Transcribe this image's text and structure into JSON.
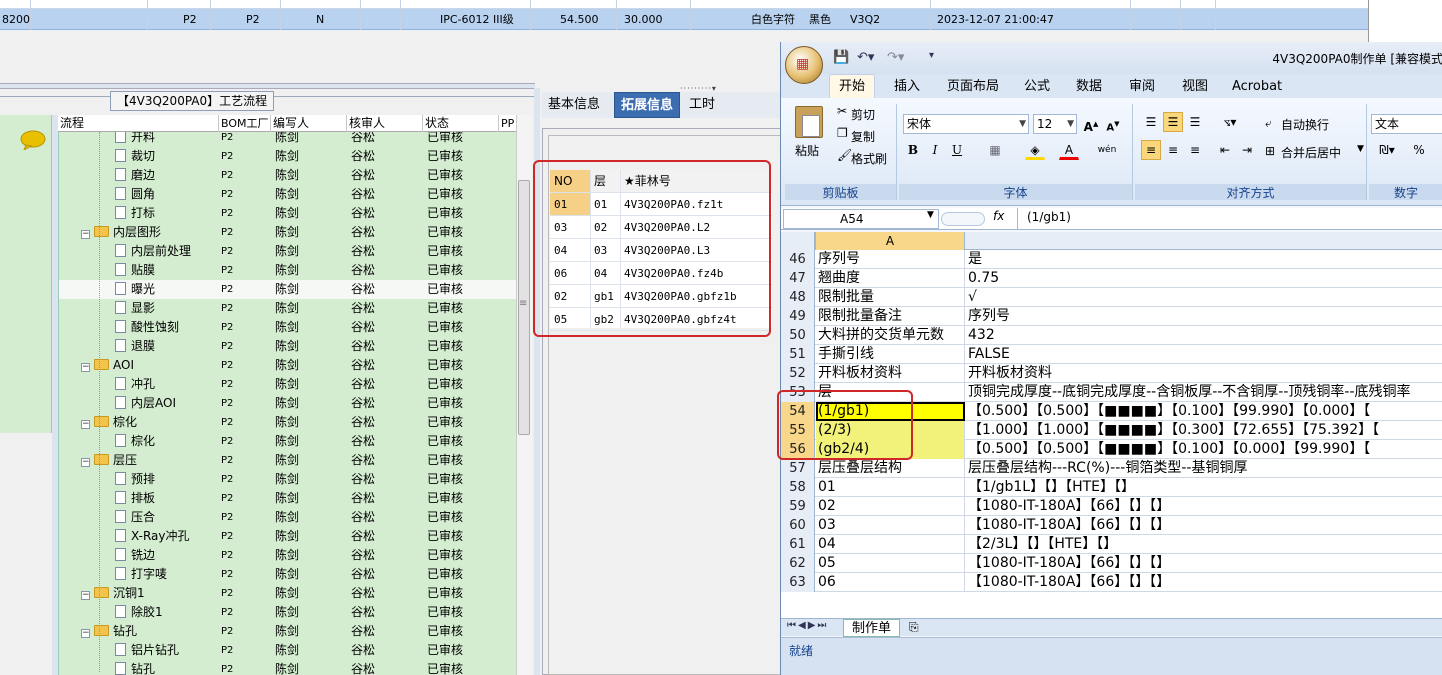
{
  "top_grid": {
    "row": [
      "8200",
      "P2",
      "P2",
      "N",
      "IPC-6012 III级",
      "54.500",
      "30.000",
      "白色字符",
      "黑色",
      "V3Q2",
      "2023-12-07 21:00:47"
    ]
  },
  "group_title": "【4V3Q200PA0】工艺流程",
  "tree": {
    "columns": [
      "流程",
      "BOM工厂",
      "编写人",
      "核审人",
      "状态",
      "PP"
    ],
    "rows": [
      {
        "name": "开料",
        "kind": "doc",
        "level": 2,
        "factory": "P2",
        "writer": "陈剑",
        "checker": "谷松",
        "status": "已审核"
      },
      {
        "name": "裁切",
        "kind": "doc",
        "level": 2,
        "factory": "P2",
        "writer": "陈剑",
        "checker": "谷松",
        "status": "已审核"
      },
      {
        "name": "磨边",
        "kind": "doc",
        "level": 2,
        "factory": "P2",
        "writer": "陈剑",
        "checker": "谷松",
        "status": "已审核"
      },
      {
        "name": "圆角",
        "kind": "doc",
        "level": 2,
        "factory": "P2",
        "writer": "陈剑",
        "checker": "谷松",
        "status": "已审核"
      },
      {
        "name": "打标",
        "kind": "doc",
        "level": 2,
        "factory": "P2",
        "writer": "陈剑",
        "checker": "谷松",
        "status": "已审核"
      },
      {
        "name": "内层图形",
        "kind": "folder",
        "level": 1,
        "factory": "P2",
        "writer": "陈剑",
        "checker": "谷松",
        "status": "已审核"
      },
      {
        "name": "内层前处理",
        "kind": "doc",
        "level": 2,
        "factory": "P2",
        "writer": "陈剑",
        "checker": "谷松",
        "status": "已审核"
      },
      {
        "name": "贴膜",
        "kind": "doc",
        "level": 2,
        "factory": "P2",
        "writer": "陈剑",
        "checker": "谷松",
        "status": "已审核"
      },
      {
        "name": "曝光",
        "kind": "doc",
        "level": 2,
        "factory": "P2",
        "writer": "陈剑",
        "checker": "谷松",
        "status": "已审核",
        "selected": true
      },
      {
        "name": "显影",
        "kind": "doc",
        "level": 2,
        "factory": "P2",
        "writer": "陈剑",
        "checker": "谷松",
        "status": "已审核"
      },
      {
        "name": "酸性蚀刻",
        "kind": "doc",
        "level": 2,
        "factory": "P2",
        "writer": "陈剑",
        "checker": "谷松",
        "status": "已审核"
      },
      {
        "name": "退膜",
        "kind": "doc",
        "level": 2,
        "factory": "P2",
        "writer": "陈剑",
        "checker": "谷松",
        "status": "已审核"
      },
      {
        "name": "AOI",
        "kind": "folder",
        "level": 1,
        "factory": "P2",
        "writer": "陈剑",
        "checker": "谷松",
        "status": "已审核"
      },
      {
        "name": "冲孔",
        "kind": "doc",
        "level": 2,
        "factory": "P2",
        "writer": "陈剑",
        "checker": "谷松",
        "status": "已审核"
      },
      {
        "name": "内层AOI",
        "kind": "doc",
        "level": 2,
        "factory": "P2",
        "writer": "陈剑",
        "checker": "谷松",
        "status": "已审核"
      },
      {
        "name": "棕化",
        "kind": "folder",
        "level": 1,
        "factory": "P2",
        "writer": "陈剑",
        "checker": "谷松",
        "status": "已审核"
      },
      {
        "name": "棕化",
        "kind": "doc",
        "level": 2,
        "factory": "P2",
        "writer": "陈剑",
        "checker": "谷松",
        "status": "已审核"
      },
      {
        "name": "层压",
        "kind": "folder",
        "level": 1,
        "factory": "P2",
        "writer": "陈剑",
        "checker": "谷松",
        "status": "已审核"
      },
      {
        "name": "预排",
        "kind": "doc",
        "level": 2,
        "factory": "P2",
        "writer": "陈剑",
        "checker": "谷松",
        "status": "已审核"
      },
      {
        "name": "排板",
        "kind": "doc",
        "level": 2,
        "factory": "P2",
        "writer": "陈剑",
        "checker": "谷松",
        "status": "已审核"
      },
      {
        "name": "压合",
        "kind": "doc",
        "level": 2,
        "factory": "P2",
        "writer": "陈剑",
        "checker": "谷松",
        "status": "已审核"
      },
      {
        "name": "X-Ray冲孔",
        "kind": "doc",
        "level": 2,
        "factory": "P2",
        "writer": "陈剑",
        "checker": "谷松",
        "status": "已审核"
      },
      {
        "name": "铣边",
        "kind": "doc",
        "level": 2,
        "factory": "P2",
        "writer": "陈剑",
        "checker": "谷松",
        "status": "已审核"
      },
      {
        "name": "打字唛",
        "kind": "doc",
        "level": 2,
        "factory": "P2",
        "writer": "陈剑",
        "checker": "谷松",
        "status": "已审核"
      },
      {
        "name": "沉铜1",
        "kind": "folder",
        "level": 1,
        "factory": "P2",
        "writer": "陈剑",
        "checker": "谷松",
        "status": "已审核"
      },
      {
        "name": "除胶1",
        "kind": "doc",
        "level": 2,
        "factory": "P2",
        "writer": "陈剑",
        "checker": "谷松",
        "status": "已审核"
      },
      {
        "name": "钻孔",
        "kind": "folder",
        "level": 1,
        "factory": "P2",
        "writer": "陈剑",
        "checker": "谷松",
        "status": "已审核"
      },
      {
        "name": "铝片钻孔",
        "kind": "doc",
        "level": 2,
        "factory": "P2",
        "writer": "陈剑",
        "checker": "谷松",
        "status": "已审核"
      },
      {
        "name": "钻孔",
        "kind": "doc",
        "level": 2,
        "factory": "P2",
        "writer": "陈剑",
        "checker": "谷松",
        "status": "已审核"
      }
    ]
  },
  "detail_tabs": {
    "tab1": "基本信息",
    "tab2": "拓展信息",
    "tab3": "工时"
  },
  "layers": {
    "columns": [
      "NO",
      "层",
      "★菲林号"
    ],
    "rows": [
      [
        "01",
        "01",
        "4V3Q200PA0.fz1t"
      ],
      [
        "03",
        "02",
        "4V3Q200PA0.L2"
      ],
      [
        "04",
        "03",
        "4V3Q200PA0.L3"
      ],
      [
        "06",
        "04",
        "4V3Q200PA0.fz4b"
      ],
      [
        "02",
        "gb1",
        "4V3Q200PA0.gbfz1b"
      ],
      [
        "05",
        "gb2",
        "4V3Q200PA0.gbfz4t"
      ]
    ]
  },
  "excel": {
    "title": "4V3Q200PA0制作单 [兼容模式",
    "ribbon_tabs": [
      "开始",
      "插入",
      "页面布局",
      "公式",
      "数据",
      "审阅",
      "视图",
      "Acrobat"
    ],
    "clipboard": {
      "paste": "粘贴",
      "cut": "剪切",
      "copy": "复制",
      "format_painter": "格式刷",
      "label": "剪贴板"
    },
    "font": {
      "name": "宋体",
      "size": "12",
      "label": "字体",
      "bold": "B",
      "italic": "I",
      "underline": "U",
      "font_color": "A",
      "phonetic": "wén"
    },
    "alignment": {
      "wrap": "自动换行",
      "merge": "合并后居中",
      "label": "对齐方式"
    },
    "number": {
      "format": "文本",
      "label": "数字",
      "percent": "%"
    },
    "name_box": "A54",
    "fx": "fx",
    "formula": "(1/gb1)",
    "column_header": "A",
    "rows": [
      {
        "n": "46",
        "a": "序列号",
        "b": "是"
      },
      {
        "n": "47",
        "a": "翘曲度",
        "b": "0.75"
      },
      {
        "n": "48",
        "a": "限制批量",
        "b": "√"
      },
      {
        "n": "49",
        "a": "限制批量备注",
        "b": "序列号"
      },
      {
        "n": "50",
        "a": "大料拼的交货单元数",
        "b": "432"
      },
      {
        "n": "51",
        "a": "手撕引线",
        "b": "FALSE"
      },
      {
        "n": "52",
        "a": "开料板材资料",
        "b": "开料板材资料"
      },
      {
        "n": "53",
        "a": "层",
        "b": "顶铜完成厚度--底铜完成厚度--含铜板厚--不含铜厚--顶残铜率--底残铜率"
      },
      {
        "n": "54",
        "a": "(1/gb1)",
        "b": "【0.500】【0.500】【■■■■】【0.100】【99.990】【0.000】【",
        "hl": "yellow",
        "sel": true
      },
      {
        "n": "55",
        "a": "(2/3)",
        "b": "【1.000】【1.000】【■■■■】【0.300】【72.655】【75.392】【",
        "hl": "yel2",
        "sel": true
      },
      {
        "n": "56",
        "a": "(gb2/4)",
        "b": "【0.500】【0.500】【■■■■】【0.100】【0.000】【99.990】【",
        "hl": "yel2",
        "sel": true
      },
      {
        "n": "57",
        "a": "层压叠层结构",
        "b": "层压叠层结构---RC(%)---铜箔类型--基铜铜厚"
      },
      {
        "n": "58",
        "a": "01",
        "b": "【1/gb1L】【】【HTE】【】"
      },
      {
        "n": "59",
        "a": "02",
        "b": "【1080-IT-180A】【66】【】【】"
      },
      {
        "n": "60",
        "a": "03",
        "b": "【1080-IT-180A】【66】【】【】"
      },
      {
        "n": "61",
        "a": "04",
        "b": "【2/3L】【】【HTE】【】"
      },
      {
        "n": "62",
        "a": "05",
        "b": "【1080-IT-180A】【66】【】【】"
      },
      {
        "n": "63",
        "a": "06",
        "b": "【1080-IT-180A】【66】【】【】"
      }
    ],
    "sheet_tab": "制作单",
    "status": "就绪"
  },
  "colors": {
    "highlight_red": "#d02828",
    "tree_green": "#d4edd0",
    "selected_tab": "#3c6db0",
    "cell_yellow": "#ffff00"
  }
}
